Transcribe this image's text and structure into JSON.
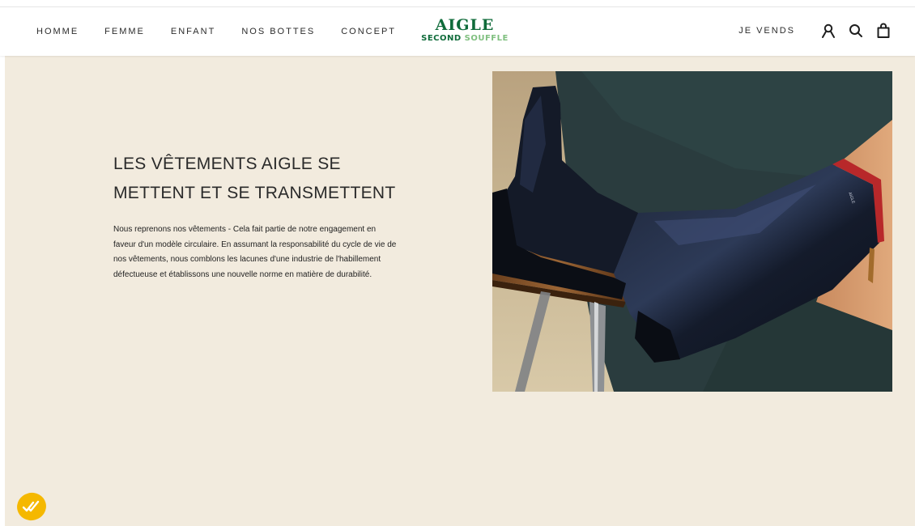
{
  "nav": {
    "left": [
      {
        "label": "HOMME"
      },
      {
        "label": "FEMME"
      },
      {
        "label": "ENFANT"
      },
      {
        "label": "NOS BOTTES"
      },
      {
        "label": "CONCEPT"
      }
    ],
    "sell_label": "JE VENDS"
  },
  "logo": {
    "main": "AIGLE",
    "sub_1": "SECOND",
    "sub_2": "SOUFFLE"
  },
  "icons": {
    "account": "account-icon",
    "search": "search-icon",
    "cart": "bag-icon",
    "badge": "checkmarks-badge-icon"
  },
  "hero": {
    "title": "LES VÊTEMENTS AIGLE SE METTENT ET SE TRANSMETTENT",
    "body": "Nous reprenons nos vêtements -  Cela fait partie de notre engagement en faveur d'un modèle circulaire. En assumant la responsabilité du cycle de vie de nos vêtements, nous comblons les lacunes d'une industrie de l'habillement défectueuse et établissons une nouvelle norme en matière de durabilité.",
    "boot_brand": "AIGLE"
  },
  "colors": {
    "brand_green": "#0f6b3a",
    "brand_light_green": "#7fbf7f",
    "section_bg": "#f2ebde",
    "badge_yellow": "#f5b800"
  }
}
